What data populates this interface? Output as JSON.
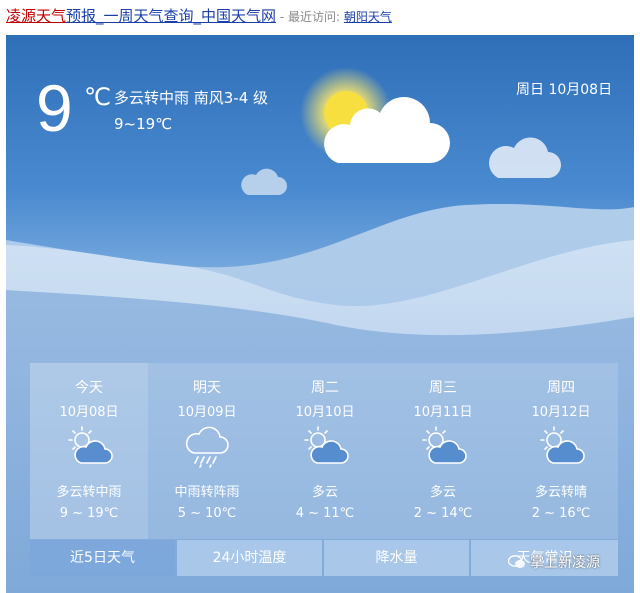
{
  "header": {
    "city_link": "凌源天气",
    "title_rest": "预报_一周天气查询_中国天气网",
    "recent_label": " - 最近访问: ",
    "recent_city": "朝阳天气"
  },
  "current": {
    "temp": "9",
    "unit": "℃",
    "condition": "多云转中雨 南风3-4 级",
    "range": "9~19℃",
    "date": "周日 10月08日",
    "icon": "sun-cloud-icon"
  },
  "forecast": [
    {
      "name": "今天",
      "date": "10月08日",
      "icon": "partly-cloudy-icon",
      "condition": "多云转中雨",
      "range": "9 ~ 19℃"
    },
    {
      "name": "明天",
      "date": "10月09日",
      "icon": "rain-icon",
      "condition": "中雨转阵雨",
      "range": "5 ~ 10℃"
    },
    {
      "name": "周二",
      "date": "10月10日",
      "icon": "partly-cloudy-icon",
      "condition": "多云",
      "range": "4 ~ 11℃"
    },
    {
      "name": "周三",
      "date": "10月11日",
      "icon": "partly-cloudy-icon",
      "condition": "多云",
      "range": "2 ~ 14℃"
    },
    {
      "name": "周四",
      "date": "10月12日",
      "icon": "partly-cloudy-icon",
      "condition": "多云转晴",
      "range": "2 ~ 16℃"
    }
  ],
  "tabs": [
    "近5日天气",
    "24小时温度",
    "降水量",
    "天气常识"
  ],
  "watermark": "掌上新凌源"
}
